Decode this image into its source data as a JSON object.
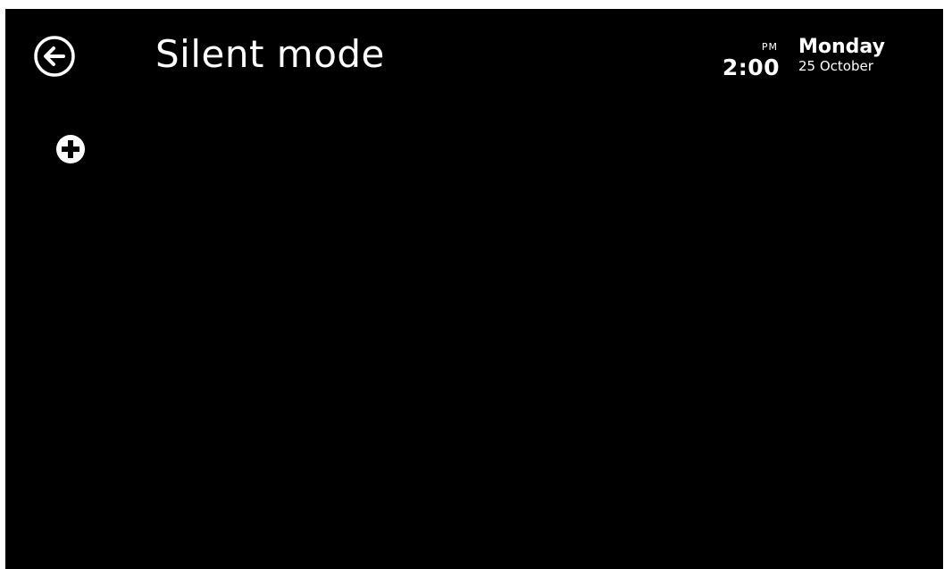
{
  "header": {
    "title": "Silent mode",
    "back_icon": "arrow-left-circle-icon"
  },
  "clock": {
    "ampm": "PM",
    "time": "2:00",
    "day": "Monday",
    "date": "25 October"
  },
  "actions": {
    "add_icon": "plus-circle-icon"
  },
  "colors": {
    "background": "#000000",
    "foreground": "#ffffff"
  }
}
